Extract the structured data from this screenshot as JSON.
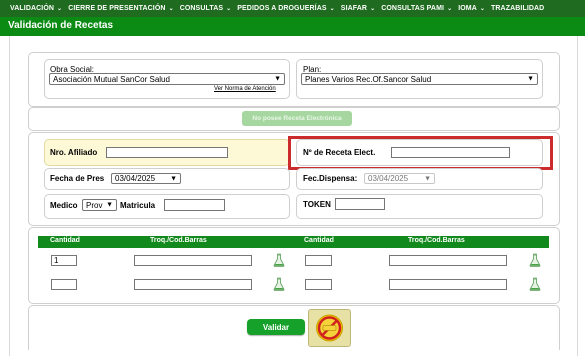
{
  "nav": {
    "items": [
      {
        "label": "VALIDACIÓN",
        "caret": true
      },
      {
        "label": "CIERRE DE PRESENTACIÓN",
        "caret": true
      },
      {
        "label": "CONSULTAS",
        "caret": true
      },
      {
        "label": "PEDIDOS A DROGUERÍAS",
        "caret": true
      },
      {
        "label": "SIAFAR",
        "caret": true
      },
      {
        "label": "CONSULTAS PAMI",
        "caret": true
      },
      {
        "label": "IOMA",
        "caret": true
      },
      {
        "label": "TRAZABILIDAD",
        "caret": false
      }
    ],
    "caret_glyph": "⌄"
  },
  "page": {
    "title": "Validación de Recetas"
  },
  "obra_social": {
    "label": "Obra Social:",
    "value": "Asociación Mutual SanCor Salud",
    "link": "Ver Norma de Atención"
  },
  "plan": {
    "label": "Plan:",
    "value": "Planes Varios Rec.Of.Sancor Salud"
  },
  "no_electronica_button": "No posee Receta Electrónica",
  "fields": {
    "afiliado_label": "Nro. Afiliado",
    "receta_label": "Nº de Receta Elect.",
    "fecha_pres_label": "Fecha de Pres",
    "fecha_pres_value": "03/04/2025",
    "fec_dispensa_label": "Fec.Dispensa:",
    "fec_dispensa_value": "03/04/2025",
    "medico_label": "Medico",
    "medico_value": "Prov",
    "matricula_label": "Matricula",
    "token_label": "TOKEN"
  },
  "table": {
    "headers": [
      "Cantidad",
      "Troq./Cod.Barras",
      "Cantidad",
      "Troq./Cod.Barras"
    ],
    "rows": [
      {
        "cantidad_1": "1",
        "cantidad_2": ""
      },
      {
        "cantidad_1": "",
        "cantidad_2": ""
      }
    ]
  },
  "validar_button": "Validar",
  "icons": {
    "flask": "flask-icon",
    "cancel": "cancel-icon",
    "chevron": "chevron-down-icon"
  },
  "colors": {
    "nav": "#1f6b1f",
    "title": "#0b8a14",
    "table_header": "#12891c",
    "highlight": "#cc2b2b"
  }
}
